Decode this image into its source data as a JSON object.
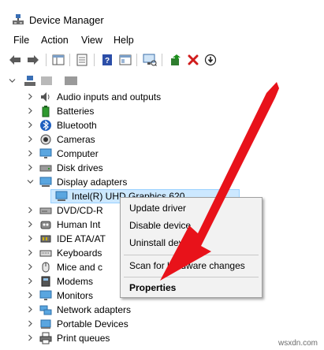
{
  "window": {
    "title": "Device Manager"
  },
  "menu": [
    "File",
    "Action",
    "View",
    "Help"
  ],
  "toolbar_icons": [
    "back-icon",
    "forward-icon",
    "properties-pane-icon",
    "show-hide-console-icon",
    "help-icon",
    "properties-icon",
    "scan-hardware-icon",
    "update-driver-icon",
    "uninstall-icon",
    "disable-icon"
  ],
  "tree": {
    "root_label": "",
    "items": [
      "Audio inputs and outputs",
      "Batteries",
      "Bluetooth",
      "Cameras",
      "Computer",
      "Disk drives",
      "Display adapters",
      "Intel(R) UHD Graphics 620",
      "DVD/CD-R",
      "Human Int",
      "IDE ATA/AT",
      "Keyboards",
      "Mice and c",
      "Modems",
      "Monitors",
      "Network adapters",
      "Portable Devices",
      "Print queues"
    ]
  },
  "context_menu": {
    "items": [
      "Update driver",
      "Disable device",
      "Uninstall device",
      "Scan for hardware changes",
      "Properties"
    ]
  },
  "annotation": {
    "arrow_color": "#e8121a"
  },
  "watermark": "wsxdn.com"
}
